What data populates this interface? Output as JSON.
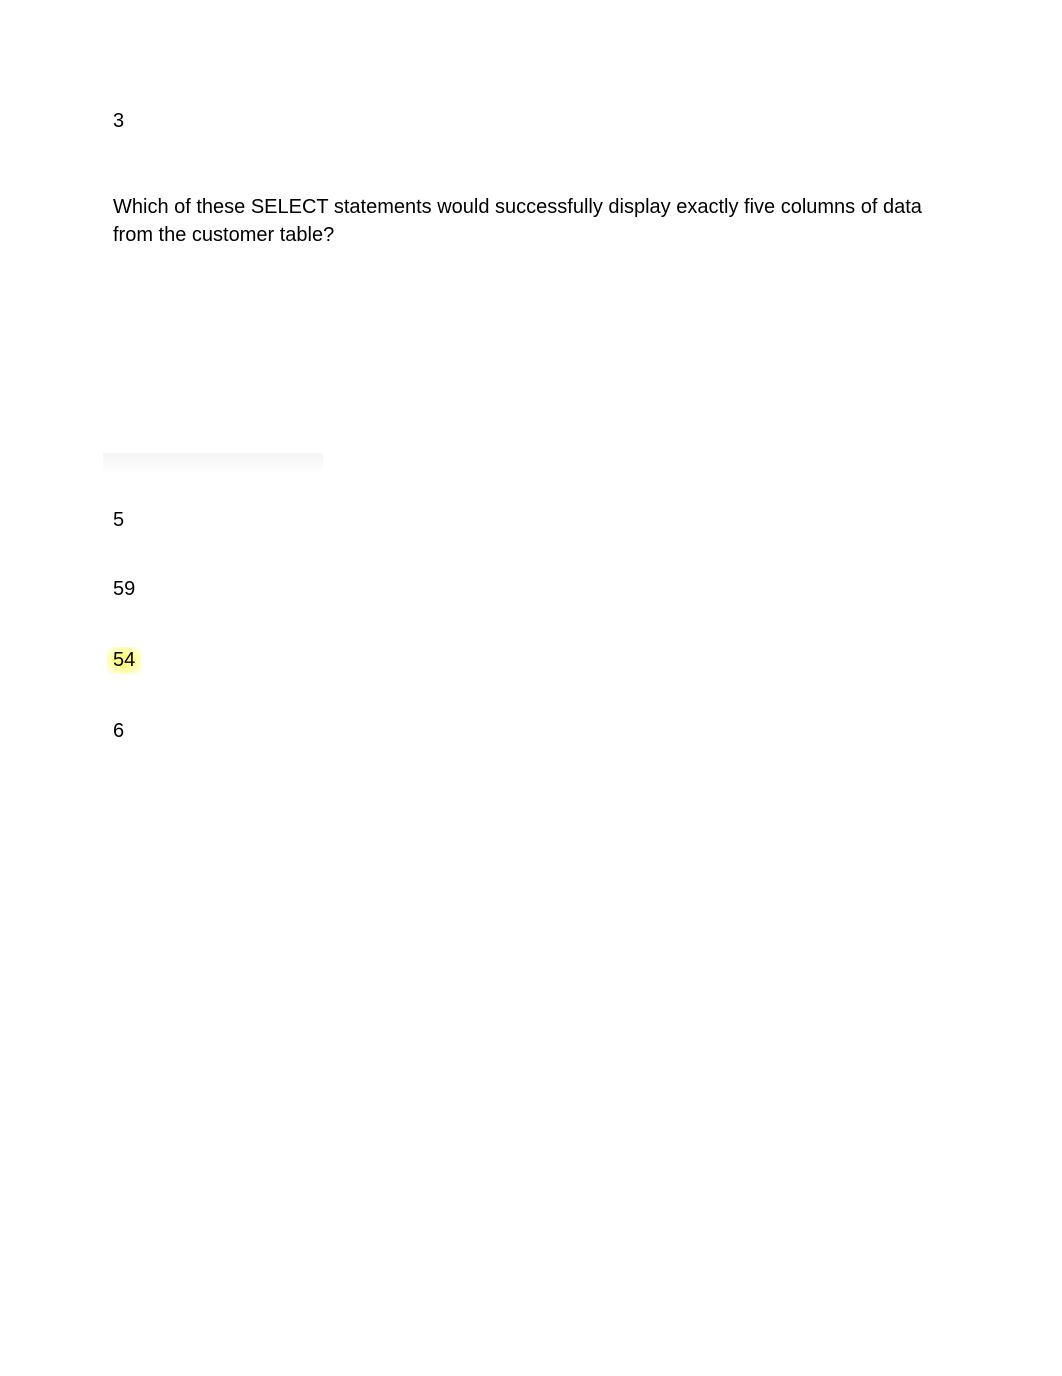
{
  "question": {
    "number": "3",
    "text": "Which of these SELECT statements would successfully display exactly five columns of data from the customer table?"
  },
  "answers": {
    "items": [
      {
        "value": "5",
        "highlighted": false
      },
      {
        "value": "59",
        "highlighted": false
      },
      {
        "value": "54",
        "highlighted": true
      },
      {
        "value": "6",
        "highlighted": false
      }
    ]
  }
}
